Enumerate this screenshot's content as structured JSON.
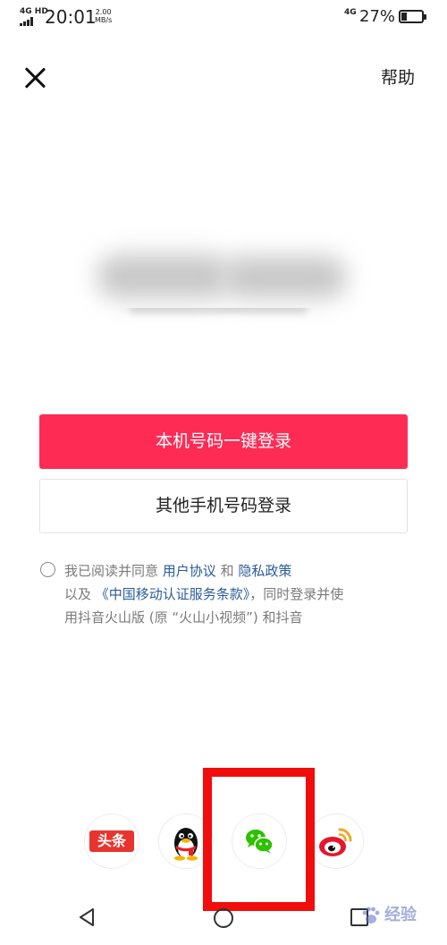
{
  "status_bar": {
    "network_left": "4G HD",
    "time": "20:01",
    "speed_value": "2.00",
    "speed_unit": "MB/s",
    "network_right": "4G",
    "battery_percent": "27%",
    "battery_level": 0.27
  },
  "header": {
    "close_icon": "close-icon",
    "help_label": "帮助"
  },
  "login": {
    "one_tap_label": "本机号码一键登录",
    "other_phone_label": "其他手机号码登录"
  },
  "agreement": {
    "checked": false,
    "prefix": "我已阅读并同意 ",
    "user_agreement": "用户协议",
    "and": " 和 ",
    "privacy_policy": "隐私政策",
    "line2_prefix": "以及 ",
    "cmcc_terms": "《中国移动认证服务条款》",
    "line2_suffix": "，同时登录并使",
    "line3": "用抖音火山版 (原 “火山小视频”) 和抖音"
  },
  "social_login": {
    "items": [
      {
        "name": "toutiao",
        "label": "头条",
        "color": "#e8342e"
      },
      {
        "name": "qq",
        "icon": "qq-penguin-icon"
      },
      {
        "name": "wechat",
        "icon": "wechat-icon",
        "color": "#2dc100"
      },
      {
        "name": "weibo",
        "icon": "weibo-icon",
        "color": "#e6162d"
      }
    ],
    "highlighted": "wechat",
    "highlight_color": "#f20d0d"
  },
  "nav_bar": {
    "back_icon": "triangle-back-icon",
    "home_icon": "circle-home-icon",
    "recent_icon": "square-recent-icon"
  },
  "watermark": {
    "text": "经验",
    "color": "#5b6bbf"
  },
  "colors": {
    "primary": "#fe2c55",
    "link": "#2a5c9a",
    "muted_text": "#7a7a7a"
  }
}
